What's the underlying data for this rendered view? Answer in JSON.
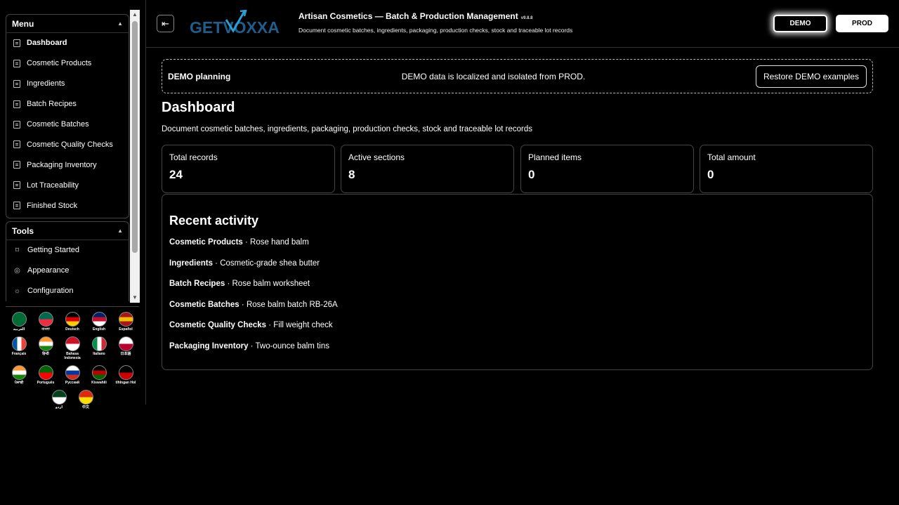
{
  "sidebar": {
    "menu_title": "Menu",
    "menu_items": [
      "Dashboard",
      "Cosmetic Products",
      "Ingredients",
      "Batch Recipes",
      "Cosmetic Batches",
      "Cosmetic Quality Checks",
      "Packaging Inventory",
      "Lot Traceability",
      "Finished Stock"
    ],
    "tools_title": "Tools",
    "tools_items": [
      {
        "label": "Getting Started",
        "icon": "rocket-icon"
      },
      {
        "label": "Appearance",
        "icon": "palette-icon"
      },
      {
        "label": "Configuration",
        "icon": "gear-icon"
      }
    ]
  },
  "languages": [
    {
      "label": "العربية",
      "colors": [
        "#006c35",
        "#006c35"
      ]
    },
    {
      "label": "বাংলা",
      "colors": [
        "#006a4e",
        "#f42a41"
      ]
    },
    {
      "label": "Deutsch",
      "colors": [
        "#000000",
        "#dd0000",
        "#ffce00"
      ]
    },
    {
      "label": "English",
      "colors": [
        "#012169",
        "#c8102e",
        "#ffffff"
      ]
    },
    {
      "label": "Español",
      "colors": [
        "#aa151b",
        "#f1bf00",
        "#aa151b"
      ]
    },
    {
      "label": "Français",
      "colors": [
        "#0055a4",
        "#ffffff",
        "#ef4135"
      ]
    },
    {
      "label": "हिन्दी",
      "colors": [
        "#ff9933",
        "#ffffff",
        "#138808"
      ]
    },
    {
      "label": "Bahasa Indonesia",
      "colors": [
        "#ce1126",
        "#ffffff"
      ]
    },
    {
      "label": "Italiano",
      "colors": [
        "#009246",
        "#ffffff",
        "#ce2b37"
      ]
    },
    {
      "label": "日本語",
      "colors": [
        "#ffffff",
        "#bc002d"
      ]
    },
    {
      "label": "ਪੰਜਾਬੀ",
      "colors": [
        "#ff9933",
        "#ffffff",
        "#138808"
      ]
    },
    {
      "label": "Português",
      "colors": [
        "#006600",
        "#ff0000"
      ]
    },
    {
      "label": "Русский",
      "colors": [
        "#ffffff",
        "#0039a6",
        "#d52b1e"
      ]
    },
    {
      "label": "Kiswahili",
      "colors": [
        "#000000",
        "#bb0000",
        "#006600"
      ]
    },
    {
      "label": "tlhIngan Hol",
      "colors": [
        "#000000",
        "#cc0000"
      ]
    },
    {
      "label": "اردو",
      "colors": [
        "#01411c",
        "#ffffff"
      ]
    },
    {
      "label": "中文",
      "colors": [
        "#de2910",
        "#ffde00"
      ]
    }
  ],
  "topbar": {
    "logo_text": "GETVOXXA",
    "title": "Artisan Cosmetics — Batch & Production Management",
    "version": "v9.8.8",
    "subtitle": "Document cosmetic batches, ingredients, packaging, production checks, stock and traceable lot records",
    "demo_label": "DEMO",
    "prod_label": "PROD"
  },
  "banner": {
    "title": "DEMO planning",
    "message": "DEMO data is localized and isolated from PROD.",
    "button": "Restore DEMO examples"
  },
  "page": {
    "title": "Dashboard",
    "subtitle": "Document cosmetic batches, ingredients, packaging, production checks, stock and traceable lot records"
  },
  "stats": [
    {
      "label": "Total records",
      "value": "24"
    },
    {
      "label": "Active sections",
      "value": "8"
    },
    {
      "label": "Planned items",
      "value": "0"
    },
    {
      "label": "Total amount",
      "value": "0"
    }
  ],
  "activity": {
    "title": "Recent activity",
    "rows": [
      {
        "section": "Cosmetic Products",
        "item": "Rose hand balm"
      },
      {
        "section": "Ingredients",
        "item": "Cosmetic-grade shea butter"
      },
      {
        "section": "Batch Recipes",
        "item": "Rose balm worksheet"
      },
      {
        "section": "Cosmetic Batches",
        "item": "Rose balm batch RB-26A"
      },
      {
        "section": "Cosmetic Quality Checks",
        "item": "Fill weight check"
      },
      {
        "section": "Packaging Inventory",
        "item": "Two-ounce balm tins"
      }
    ]
  }
}
